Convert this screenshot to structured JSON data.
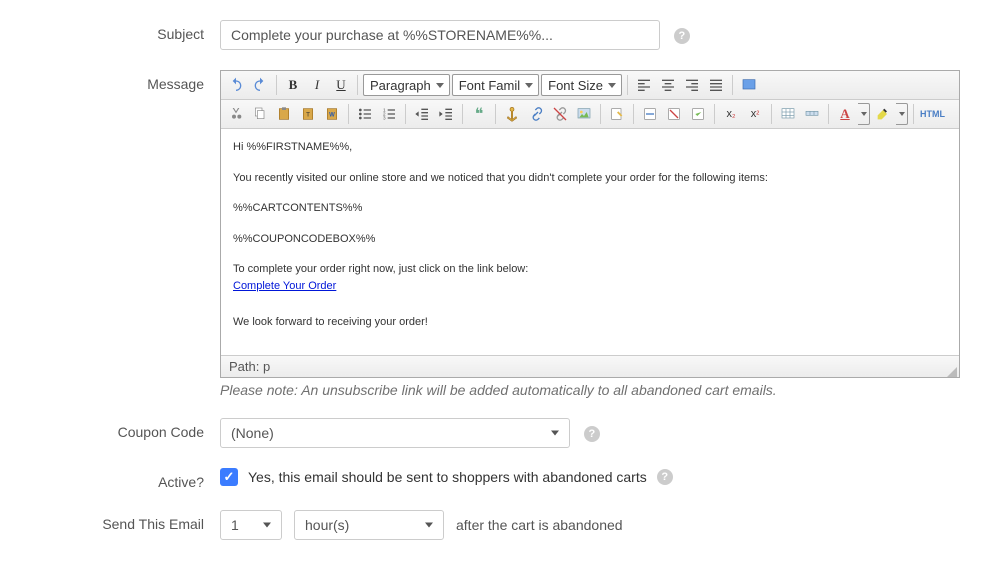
{
  "labels": {
    "subject": "Subject",
    "message": "Message",
    "coupon": "Coupon Code",
    "active": "Active?",
    "send": "Send This Email"
  },
  "subject": {
    "value": "Complete your purchase at %%STORENAME%%..."
  },
  "editor": {
    "format_selects": {
      "paragraph": "Paragraph",
      "font_family": "Font Famil",
      "font_size": "Font Size"
    },
    "toolbar_icons": [
      "undo",
      "redo",
      "sep",
      "bold",
      "italic",
      "underline",
      "sep",
      "select-paragraph",
      "select-fontfamily",
      "select-fontsize",
      "sep",
      "align-left",
      "align-center",
      "align-right",
      "align-justify",
      "sep",
      "toggle-fullscreen",
      "row2",
      "cut",
      "copy",
      "paste",
      "paste-text",
      "paste-word",
      "sep",
      "bullet-list",
      "numbered-list",
      "sep",
      "outdent",
      "indent",
      "sep",
      "blockquote",
      "sep",
      "anchor",
      "link",
      "unlink",
      "image",
      "sep",
      "edit",
      "sep",
      "insert-hr",
      "remove-format",
      "clean",
      "sep",
      "subscript",
      "superscript",
      "sep",
      "table",
      "table-row",
      "sep",
      "font-color",
      "background-color",
      "sep",
      "html-source"
    ],
    "body": {
      "line1": "Hi %%FIRSTNAME%%,",
      "line2": "You recently visited our online store and we noticed that you didn't complete your order for the following items:",
      "line3": "%%CARTCONTENTS%%",
      "line4": "%%COUPONCODEBOX%%",
      "line5": "To complete your order right now, just click on the link below:",
      "link_text": "Complete Your Order",
      "line6": "We look forward to receiving your order!"
    },
    "path_label": "Path:",
    "path_value": "p"
  },
  "note": "Please note: An unsubscribe link will be added automatically to all abandoned cart emails.",
  "coupon": {
    "selected": "(None)"
  },
  "active": {
    "checked": true,
    "text": "Yes, this email should be sent to shoppers with abandoned carts"
  },
  "send": {
    "count": "1",
    "unit": "hour(s)",
    "after_text": "after the cart is abandoned"
  }
}
